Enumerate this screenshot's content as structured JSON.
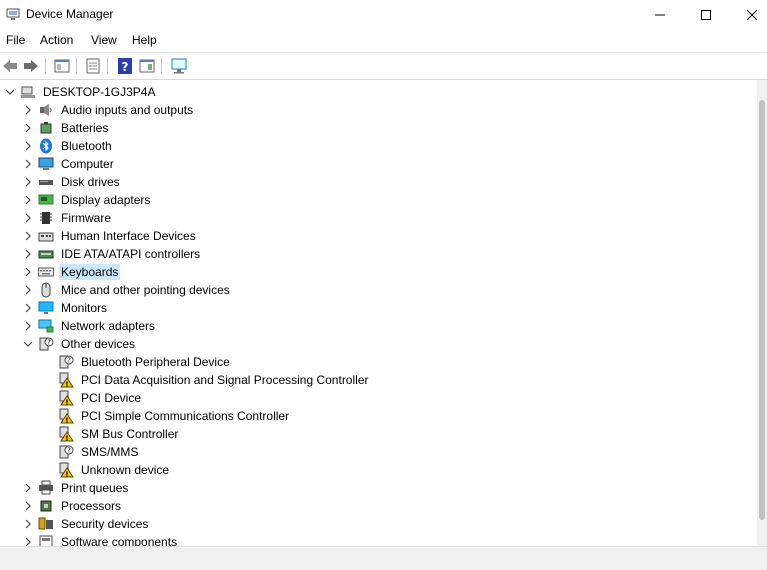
{
  "window": {
    "title": "Device Manager"
  },
  "menu": [
    "File",
    "Action",
    "View",
    "Help"
  ],
  "tree": {
    "root": "DESKTOP-1GJ3P4A",
    "categories": [
      {
        "label": "Audio inputs and outputs",
        "icon": "speaker-icon"
      },
      {
        "label": "Batteries",
        "icon": "battery-icon"
      },
      {
        "label": "Bluetooth",
        "icon": "bluetooth-icon"
      },
      {
        "label": "Computer",
        "icon": "computer-icon"
      },
      {
        "label": "Disk drives",
        "icon": "disk-drive-icon"
      },
      {
        "label": "Display adapters",
        "icon": "display-adapter-icon"
      },
      {
        "label": "Firmware",
        "icon": "chip-icon"
      },
      {
        "label": "Human Interface Devices",
        "icon": "hid-icon"
      },
      {
        "label": "IDE ATA/ATAPI controllers",
        "icon": "ide-controller-icon"
      },
      {
        "label": "Keyboards",
        "icon": "keyboard-icon",
        "selected": true
      },
      {
        "label": "Mice and other pointing devices",
        "icon": "mouse-icon"
      },
      {
        "label": "Monitors",
        "icon": "monitor-icon"
      },
      {
        "label": "Network adapters",
        "icon": "network-icon"
      },
      {
        "label": "Other devices",
        "icon": "unknown-device-icon",
        "expanded": true,
        "children": [
          {
            "label": "Bluetooth Peripheral Device",
            "icon": "unknown-device-icon"
          },
          {
            "label": "PCI Data Acquisition and Signal Processing Controller",
            "icon": "warning-device-icon"
          },
          {
            "label": "PCI Device",
            "icon": "warning-device-icon"
          },
          {
            "label": "PCI Simple Communications Controller",
            "icon": "warning-device-icon"
          },
          {
            "label": "SM Bus Controller",
            "icon": "warning-device-icon"
          },
          {
            "label": "SMS/MMS",
            "icon": "unknown-device-icon"
          },
          {
            "label": "Unknown device",
            "icon": "warning-device-icon"
          }
        ]
      },
      {
        "label": "Print queues",
        "icon": "printer-icon"
      },
      {
        "label": "Processors",
        "icon": "processor-icon"
      },
      {
        "label": "Security devices",
        "icon": "security-key-icon"
      },
      {
        "label": "Software components",
        "icon": "software-component-icon"
      }
    ]
  }
}
